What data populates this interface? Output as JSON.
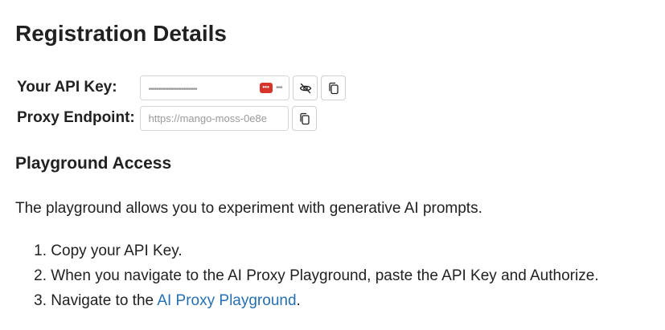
{
  "page_title": "Registration Details",
  "credentials": {
    "api_key_label": "Your API Key:",
    "api_key_masked": "••••••••••••••••••••••••",
    "api_key_masked_tail": "•••",
    "proxy_label": "Proxy Endpoint:",
    "proxy_value": "https://mango-moss-0e8e"
  },
  "icons": {
    "toggle_visibility": "eye-off-icon",
    "copy": "copy-icon"
  },
  "playground": {
    "heading": "Playground Access",
    "intro": "The playground allows you to experiment with generative AI prompts.",
    "steps": [
      {
        "num": "1.",
        "text": "Copy your API Key."
      },
      {
        "num": "2.",
        "text": "When you navigate to the AI Proxy Playground, paste the API Key and Authorize."
      },
      {
        "num": "3.",
        "text": "Navigate to the ",
        "link": "AI Proxy Playground",
        "after": "."
      }
    ]
  },
  "colors": {
    "text": "#212121",
    "link": "#2470b3",
    "password_manager_badge": "#d8342c",
    "border": "#d6d6d6"
  }
}
